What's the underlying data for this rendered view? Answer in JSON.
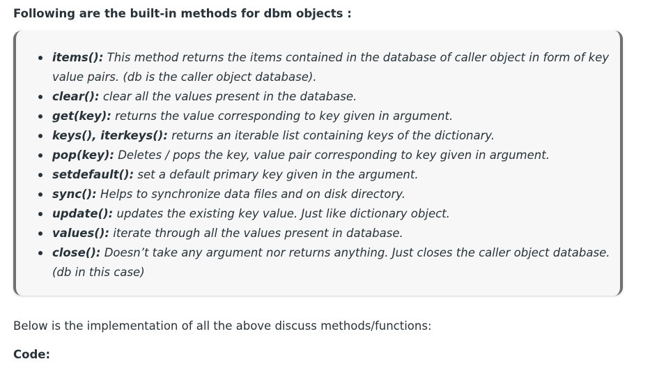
{
  "heading": "Following are the built-in methods for dbm objects :",
  "methods": [
    {
      "name": "items():",
      "desc": " This method returns the items contained in the database of caller object in form of key value pairs. (db is the caller object database)."
    },
    {
      "name": "clear():",
      "desc": " clear all the values present in the database."
    },
    {
      "name": "get(key):",
      "desc": " returns the value corresponding to key given in argument."
    },
    {
      "name": "keys(), iterkeys():",
      "desc": " returns an iterable list containing keys of the dictionary."
    },
    {
      "name": "pop(key):",
      "desc": " Deletes / pops the key, value pair corresponding to key given in argument."
    },
    {
      "name": "setdefault():",
      "desc": " set a default primary key given in the argument."
    },
    {
      "name": "sync():",
      "desc": " Helps to synchronize data files and on disk directory."
    },
    {
      "name": "update():",
      "desc": " updates the existing key value. Just like dictionary object."
    },
    {
      "name": "values():",
      "desc": " iterate through all the values present in database."
    },
    {
      "name": "close():",
      "desc": " Doesn’t take any argument nor returns anything. Just closes the caller object database. (db in this case)"
    }
  ],
  "paragraph": "Below is the implementation of all the above discuss methods/functions:",
  "code_label": "Code:"
}
